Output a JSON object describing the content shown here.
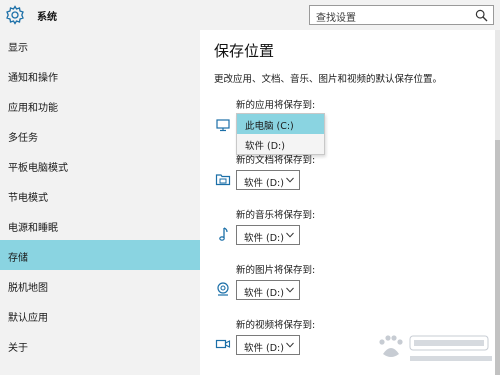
{
  "header": {
    "title": "系统",
    "search_placeholder": "查找设置"
  },
  "sidebar": {
    "items": [
      {
        "label": "显示"
      },
      {
        "label": "通知和操作"
      },
      {
        "label": "应用和功能"
      },
      {
        "label": "多任务"
      },
      {
        "label": "平板电脑模式"
      },
      {
        "label": "节电模式"
      },
      {
        "label": "电源和睡眠"
      },
      {
        "label": "存储",
        "active": true
      },
      {
        "label": "脱机地图"
      },
      {
        "label": "默认应用"
      },
      {
        "label": "关于"
      }
    ]
  },
  "main": {
    "title": "保存位置",
    "description": "更改应用、文档、音乐、图片和视频的默认保存位置。",
    "sections": [
      {
        "label": "新的应用将保存到:",
        "value": "此电脑 (C:)",
        "icon": "monitor-icon"
      },
      {
        "label": "新的文档将保存到:",
        "value": "软件 (D:)",
        "icon": "folder-icon"
      },
      {
        "label": "新的音乐将保存到:",
        "value": "软件 (D:)",
        "icon": "music-note-icon"
      },
      {
        "label": "新的图片将保存到:",
        "value": "软件 (D:)",
        "icon": "camera-icon"
      },
      {
        "label": "新的视频将保存到:",
        "value": "软件 (D:)",
        "icon": "video-camera-icon"
      }
    ],
    "dropdown_options": [
      "此电脑 (C:)",
      "软件 (D:)"
    ]
  },
  "colors": {
    "accent": "#8ad4e1",
    "sidebar_bg": "#f2f2f2",
    "icon_blue": "#1b6fa8"
  }
}
